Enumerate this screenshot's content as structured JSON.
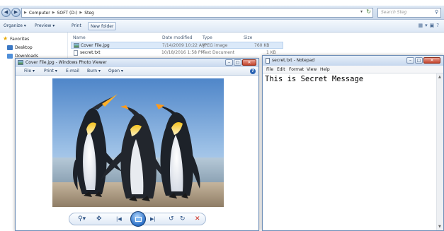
{
  "explorer": {
    "breadcrumbs": [
      "Computer",
      "SOFT (D:)",
      "Steg"
    ],
    "search_placeholder": "Search Steg",
    "toolbar": {
      "organize": "Organize ▾",
      "preview": "Preview ▾",
      "print": "Print",
      "new_folder": "New folder"
    },
    "nav": {
      "favorites": "Favorites",
      "desktop": "Desktop",
      "downloads": "Downloads"
    },
    "columns": {
      "name": "Name",
      "date": "Date modified",
      "type": "Type",
      "size": "Size"
    },
    "files": [
      {
        "name": "Cover File.jpg",
        "date": "7/14/2009 10:22 AM",
        "type": "JPEG image",
        "size": "760 KB"
      },
      {
        "name": "secret.txt",
        "date": "10/18/2016 1:58 PM",
        "type": "Text Document",
        "size": "1 KB"
      }
    ]
  },
  "viewer": {
    "title": "Cover File.jpg - Windows Photo Viewer",
    "menu": [
      "File ▾",
      "Print ▾",
      "E-mail",
      "Burn ▾",
      "Open ▾"
    ],
    "help": "?"
  },
  "notepad": {
    "title": "secret.txt - Notepad",
    "menu": [
      "File",
      "Edit",
      "Format",
      "View",
      "Help"
    ],
    "content": "This is Secret Message"
  },
  "colors": {
    "accent": "#2a6fc6",
    "title_bar": "#c7d8ee",
    "close": "#c3432b"
  }
}
